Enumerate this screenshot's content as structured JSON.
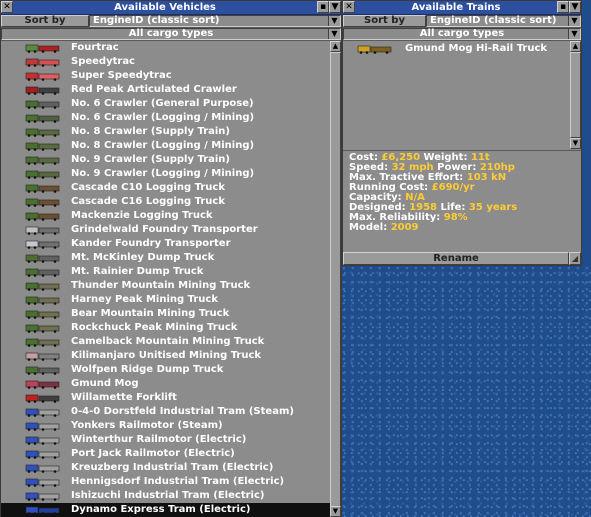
{
  "left": {
    "title": "Available Vehicles",
    "sort_label": "Sort by",
    "sort_value": "EngineID (classic sort)",
    "cargo_filter": "All cargo types",
    "items": [
      {
        "label": "Fourtrac",
        "icon": "tractor-icon",
        "c1": "#5a8a3a",
        "c2": "#b02020"
      },
      {
        "label": "Speedytrac",
        "icon": "tractor-icon",
        "c1": "#c03a3a",
        "c2": "#d85050"
      },
      {
        "label": "Super Speedytrac",
        "icon": "tractor-icon",
        "c1": "#c83030",
        "c2": "#e06060"
      },
      {
        "label": "Red Peak Articulated Crawler",
        "icon": "crawler-icon",
        "c1": "#a02020",
        "c2": "#404040"
      },
      {
        "label": "No. 6 Crawler (General Purpose)",
        "icon": "crawler-icon",
        "c1": "#4a7030",
        "c2": "#606060"
      },
      {
        "label": "No. 6 Crawler (Logging / Mining)",
        "icon": "crawler-icon",
        "c1": "#4a7030",
        "c2": "#506040"
      },
      {
        "label": "No. 8 Crawler (Supply Train)",
        "icon": "crawler-icon",
        "c1": "#4a7030",
        "c2": "#5a6a40"
      },
      {
        "label": "No. 8 Crawler (Logging / Mining)",
        "icon": "crawler-icon",
        "c1": "#4a7030",
        "c2": "#5a6a40"
      },
      {
        "label": "No. 9 Crawler (Supply Train)",
        "icon": "crawler-icon",
        "c1": "#4a7030",
        "c2": "#5a6a40"
      },
      {
        "label": "No. 9 Crawler (Logging / Mining)",
        "icon": "crawler-icon",
        "c1": "#4a7030",
        "c2": "#5a6a40"
      },
      {
        "label": "Cascade C10 Logging Truck",
        "icon": "logging-truck-icon",
        "c1": "#4a7030",
        "c2": "#6a5030"
      },
      {
        "label": "Cascade C16 Logging Truck",
        "icon": "logging-truck-icon",
        "c1": "#4a7030",
        "c2": "#6a5030"
      },
      {
        "label": "Mackenzie Logging Truck",
        "icon": "logging-truck-icon",
        "c1": "#4a7030",
        "c2": "#6a5030"
      },
      {
        "label": "Grindelwald Foundry Transporter",
        "icon": "transporter-icon",
        "c1": "#c0c0c0",
        "c2": "#707070"
      },
      {
        "label": "Kander Foundry Transporter",
        "icon": "transporter-icon",
        "c1": "#c8c8c8",
        "c2": "#707070"
      },
      {
        "label": "Mt. McKinley Dump Truck",
        "icon": "dump-truck-icon",
        "c1": "#4a7030",
        "c2": "#606060"
      },
      {
        "label": "Mt. Rainier Dump Truck",
        "icon": "dump-truck-icon",
        "c1": "#4a7030",
        "c2": "#606060"
      },
      {
        "label": "Thunder Mountain Mining Truck",
        "icon": "mining-truck-icon",
        "c1": "#4a7030",
        "c2": "#707050"
      },
      {
        "label": "Harney Peak Mining Truck",
        "icon": "mining-truck-icon",
        "c1": "#4a7030",
        "c2": "#707050"
      },
      {
        "label": "Bear Mountain Mining Truck",
        "icon": "mining-truck-icon",
        "c1": "#4a7030",
        "c2": "#707050"
      },
      {
        "label": "Rockchuck Peak Mining Truck",
        "icon": "mining-truck-icon",
        "c1": "#4a7030",
        "c2": "#707050"
      },
      {
        "label": "Camelback Mountain Mining Truck",
        "icon": "mining-truck-icon",
        "c1": "#4a7030",
        "c2": "#707050"
      },
      {
        "label": "Kilimanjaro Unitised Mining Truck",
        "icon": "mining-truck-icon",
        "c1": "#c0a0a0",
        "c2": "#808080"
      },
      {
        "label": "Wolfpen Ridge Dump Truck",
        "icon": "dump-truck-icon",
        "c1": "#4a7030",
        "c2": "#606060"
      },
      {
        "label": "Gmund Mog",
        "icon": "mog-icon",
        "c1": "#c04060",
        "c2": "#803040"
      },
      {
        "label": "Willamette Forklift",
        "icon": "forklift-icon",
        "c1": "#c02020",
        "c2": "#404040"
      },
      {
        "label": "0-4-0 Dorstfeld Industrial Tram (Steam)",
        "icon": "tram-icon",
        "c1": "#3050c0",
        "c2": "#a0a0a0"
      },
      {
        "label": "Yonkers Railmotor (Steam)",
        "icon": "railmotor-icon",
        "c1": "#3050c0",
        "c2": "#a0a0a0"
      },
      {
        "label": "Winterthur Railmotor (Electric)",
        "icon": "railmotor-icon",
        "c1": "#3050c0",
        "c2": "#a0a0a0"
      },
      {
        "label": "Port Jack Railmotor (Electric)",
        "icon": "railmotor-icon",
        "c1": "#3050c0",
        "c2": "#a0a0a0"
      },
      {
        "label": "Kreuzberg Industrial Tram (Electric)",
        "icon": "tram-icon",
        "c1": "#3050c0",
        "c2": "#a0a0a0"
      },
      {
        "label": "Hennigsdorf Industrial Tram (Electric)",
        "icon": "tram-icon",
        "c1": "#3050c0",
        "c2": "#a0a0a0"
      },
      {
        "label": "Ishizuchi Industrial Tram (Electric)",
        "icon": "tram-icon",
        "c1": "#3050c0",
        "c2": "#a0a0a0"
      },
      {
        "label": "Dynamo Express Tram (Electric)",
        "icon": "tram-icon",
        "c1": "#3050c0",
        "c2": "#2040a0"
      }
    ],
    "selected_index": 33
  },
  "right": {
    "title": "Available Trains",
    "sort_label": "Sort by",
    "sort_value": "EngineID (classic sort)",
    "cargo_filter": "All cargo types",
    "items": [
      {
        "label": "Gmund Mog Hi-Rail Truck",
        "icon": "mog-hirail-icon",
        "c1": "#d0a020",
        "c2": "#806020"
      }
    ],
    "info": {
      "cost_label": "Cost:",
      "cost": "£6,250",
      "weight_label": "Weight:",
      "weight": "11t",
      "speed_label": "Speed:",
      "speed": "32 mph",
      "power_label": "Power:",
      "power": "210hp",
      "tractive_label": "Max. Tractive Effort:",
      "tractive": "103 kN",
      "running_label": "Running Cost:",
      "running": "£690/yr",
      "capacity_label": "Capacity:",
      "capacity": "N/A",
      "designed_label": "Designed:",
      "designed": "1958",
      "life_label": "Life:",
      "life": "35 years",
      "reliability_label": "Max. Reliability:",
      "reliability": "98%",
      "model_label": "Model:",
      "model": "2009"
    },
    "rename_label": "Rename"
  },
  "colors": {
    "titlebar": "#2c4fa0",
    "panel": "#8c8c8c",
    "value_text": "#ffcc33",
    "water": "#1f4d8c"
  }
}
